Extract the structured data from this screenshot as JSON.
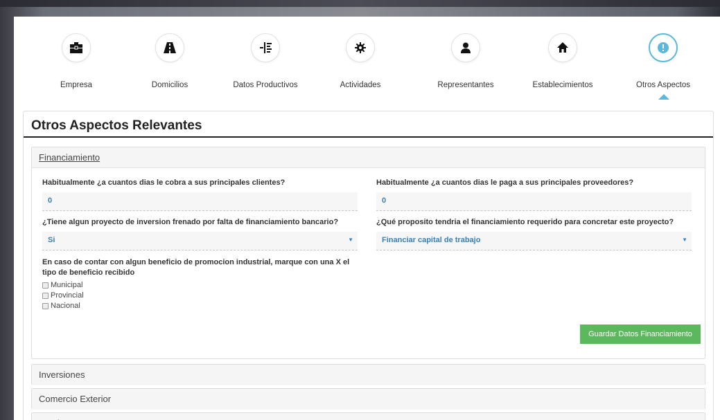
{
  "steps": [
    {
      "label": "Empresa",
      "icon": "briefcase-icon"
    },
    {
      "label": "Domicilios",
      "icon": "road-icon"
    },
    {
      "label": "Datos Productivos",
      "icon": "indent-icon"
    },
    {
      "label": "Actividades",
      "icon": "cog-icon"
    },
    {
      "label": "Representantes",
      "icon": "user-icon"
    },
    {
      "label": "Establecimientos",
      "icon": "home-icon"
    },
    {
      "label": "Otros Aspectos",
      "icon": "exclamation-icon",
      "active": true
    }
  ],
  "page_title": "Otros Aspectos Relevantes",
  "financiamiento": {
    "title": "Financiamiento",
    "q1": "Habitualmente ¿a cuantos dias le cobra a sus principales clientes?",
    "q1_value": "0",
    "q2": "Habitualmente ¿a cuantos dias le paga a sus principales proveedores?",
    "q2_value": "0",
    "q3": "¿Tiene algun proyecto de inversion frenado por falta de financiamiento bancario?",
    "q3_value": "Si",
    "q4": "¿Qué proposito tendria el financiamiento requerido para concretar este proyecto?",
    "q4_value": "Financiar capital de trabajo",
    "q5": "En caso de contar con algun beneficio de promocion industrial, marque con una X el tipo de beneficio recibido",
    "options": [
      "Municipal",
      "Provincial",
      "Nacional"
    ],
    "save_label": "Guardar Datos Financiamiento"
  },
  "sections": [
    "Inversiones",
    "Comercio Exterior",
    "Empleo y RRHH"
  ],
  "colors": {
    "accent": "#5bb8dc",
    "save": "#5cb85c",
    "value": "#3a7fb8"
  }
}
